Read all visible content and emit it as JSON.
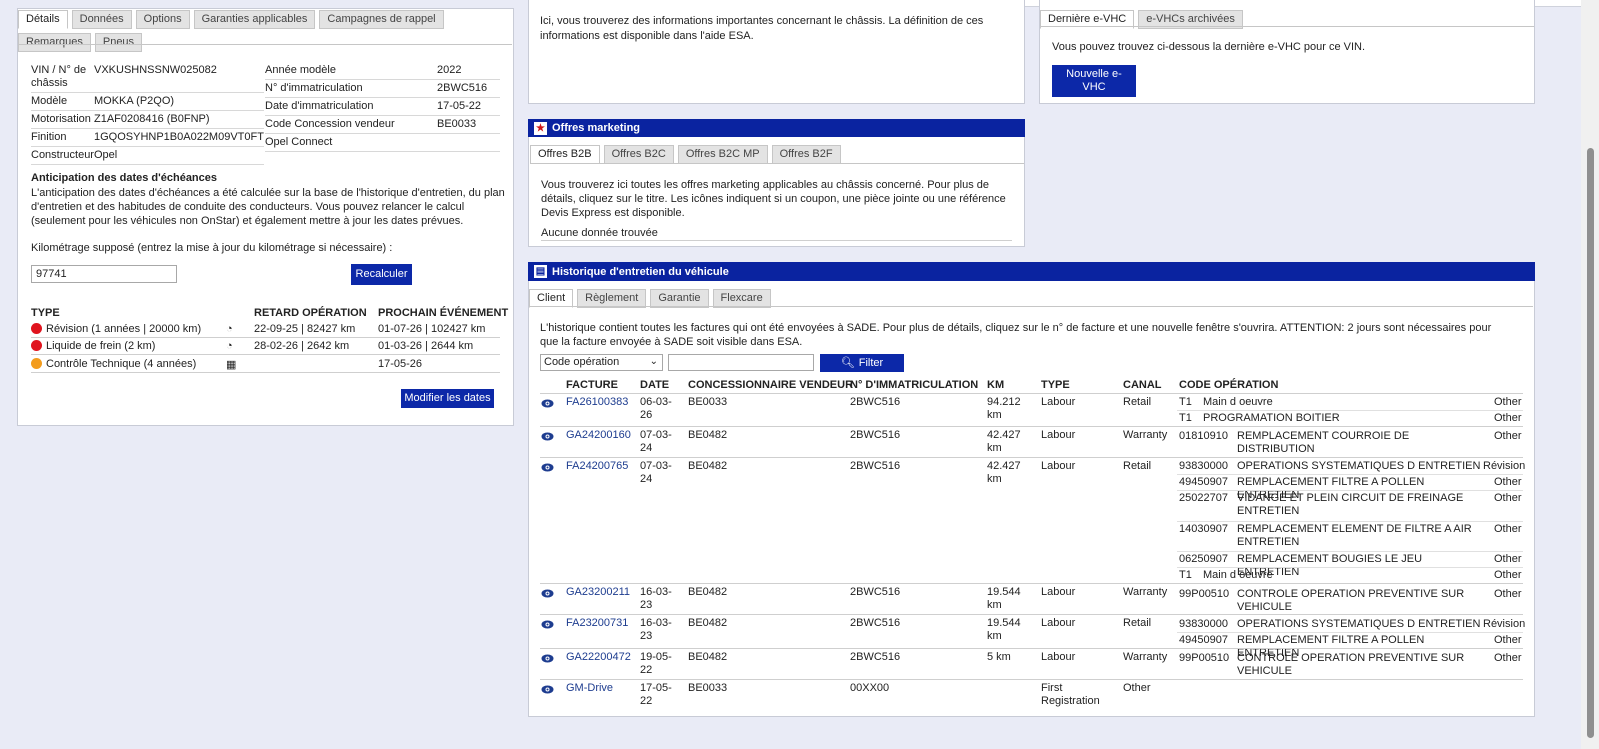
{
  "vehicle_tabs": [
    "Détails",
    "Données",
    "Options",
    "Garanties applicables",
    "Campagnes de rappel",
    "Remarques",
    "Pneus"
  ],
  "details_left": [
    {
      "label": "VIN / N° de châssis",
      "value": "VXKUSHNSSNW025082"
    },
    {
      "label": "Modèle",
      "value": "MOKKA (P2QO)"
    },
    {
      "label": "Motorisation",
      "value": "Z1AF0208416 (B0FNP)"
    },
    {
      "label": "Finition",
      "value": "1GQOSYHNP1B0A022M09VT0FT"
    },
    {
      "label": "Constructeur",
      "value": "Opel"
    }
  ],
  "details_right": [
    {
      "label": "Année modèle",
      "value": "2022"
    },
    {
      "label": "N° d'immatriculation",
      "value": "2BWC516"
    },
    {
      "label": "Date d'immatriculation",
      "value": "17-05-22"
    },
    {
      "label": "Code Concession vendeur",
      "value": "BE0033"
    },
    {
      "label": "Opel Connect",
      "value": ""
    }
  ],
  "anticipation": {
    "title": "Anticipation des dates d'échéances",
    "text": "L'anticipation des dates d'échéances a été calculée sur la base de l'historique d'entretien, du plan d'entretien et des habitudes de conduite des conducteurs. Vous pouvez relancer le calcul (seulement pour les véhicules non OnStar) et également mettre à jour les dates prévues.",
    "mileage_label": "Kilométrage supposé (entrez la mise à jour du kilométrage si nécessaire) :",
    "mileage_value": "97741",
    "recalc_button": "Recalculer",
    "columns": [
      "TYPE",
      "RETARD OPÉRATION",
      "PROCHAIN ÉVÉNEMENT"
    ],
    "rows": [
      {
        "status": "red",
        "type": "Révision (1 années | 20000 km)",
        "icon": "gauge-icon",
        "late": "22-09-25 | 82427 km",
        "next": "01-07-26 | 102427 km"
      },
      {
        "status": "red",
        "type": "Liquide de frein (2 km)",
        "icon": "gauge-icon",
        "late": "28-02-26 | 2642 km",
        "next": "01-03-26 | 2644 km"
      },
      {
        "status": "orange",
        "type": "Contrôle Technique (4 années)",
        "icon": "calendar-icon",
        "late": "",
        "next": "17-05-26"
      }
    ],
    "modify_button": "Modifier les dates"
  },
  "chassis_info": {
    "text": "Ici, vous trouverez des informations importantes concernant le châssis. La définition de ces informations est disponible dans l'aide ESA."
  },
  "evhc": {
    "tabs": [
      "Dernière e-VHC",
      "e-VHCs archivées"
    ],
    "text": "Vous pouvez trouvez ci-dessous la dernière e-VHC pour ce VIN.",
    "button": "Nouvelle e-VHC"
  },
  "offers": {
    "title": "Offres marketing",
    "tabs": [
      "Offres B2B",
      "Offres B2C",
      "Offres B2C MP",
      "Offres B2F"
    ],
    "text": "Vous trouverez ici toutes les offres marketing applicables au châssis concerné. Pour plus de détails, cliquez sur le titre. Les icônes indiquent si un coupon, une pièce jointe ou une référence Devis Express est disponible.",
    "empty": "Aucune donnée trouvée"
  },
  "history": {
    "title": "Historique d'entretien du véhicule",
    "tabs": [
      "Client",
      "Règlement",
      "Garantie",
      "Flexcare"
    ],
    "text": "L'historique contient toutes les factures qui ont été envoyées à SADE. Pour plus de détails, cliquez sur le n° de facture et une nouvelle fenêtre s'ouvrira. ATTENTION: 2 jours sont nécessaires pour que la facture envoyée à SADE soit visible dans ESA.",
    "filter_select": "Code opération",
    "filter_value": "",
    "filter_button": "Filter",
    "columns": [
      "FACTURE",
      "DATE",
      "CONCESSIONNAIRE VENDEUR",
      "N° D'IMMATRICULATION",
      "KM",
      "TYPE",
      "CANAL",
      "CODE OPÉRATION"
    ],
    "rows": [
      {
        "invoice": "FA26100383",
        "date": "06-03-26",
        "dealer": "BE0033",
        "plate": "2BWC516",
        "km": "94.212 km",
        "type": "Labour",
        "channel": "Retail",
        "ops": [
          {
            "code": "T1",
            "desc": "Main d oeuvre",
            "cat": "Other"
          },
          {
            "code": "T1",
            "desc": "PROGRAMATION BOITIER",
            "cat": "Other"
          }
        ]
      },
      {
        "invoice": "GA24200160",
        "date": "07-03-24",
        "dealer": "BE0482",
        "plate": "2BWC516",
        "km": "42.427 km",
        "type": "Labour",
        "channel": "Warranty",
        "ops": [
          {
            "code": "01810910",
            "desc": "REMPLACEMENT COURROIE DE DISTRIBUTION",
            "cat": "Other"
          }
        ]
      },
      {
        "invoice": "FA24200765",
        "date": "07-03-24",
        "dealer": "BE0482",
        "plate": "2BWC516",
        "km": "42.427 km",
        "type": "Labour",
        "channel": "Retail",
        "ops": [
          {
            "code": "93830000",
            "desc": "OPERATIONS SYSTEMATIQUES D ENTRETIEN",
            "cat": "Révision"
          },
          {
            "code": "49450907",
            "desc": "REMPLACEMENT FILTRE A POLLEN ENTRETIEN",
            "cat": "Other"
          },
          {
            "code": "25022707",
            "desc": "VIDANGE ET PLEIN CIRCUIT DE FREINAGE ENTRETIEN",
            "cat": "Other"
          },
          {
            "code": "14030907",
            "desc": "REMPLACEMENT ELEMENT DE FILTRE A AIR ENTRETIEN",
            "cat": "Other"
          },
          {
            "code": "06250907",
            "desc": "REMPLACEMENT BOUGIES LE JEU ENTRETIEN",
            "cat": "Other"
          },
          {
            "code": "T1",
            "desc": "Main d oeuvre",
            "cat": "Other"
          }
        ]
      },
      {
        "invoice": "GA23200211",
        "date": "16-03-23",
        "dealer": "BE0482",
        "plate": "2BWC516",
        "km": "19.544 km",
        "type": "Labour",
        "channel": "Warranty",
        "ops": [
          {
            "code": "99P00510",
            "desc": "CONTROLE OPERATION PREVENTIVE SUR VEHICULE",
            "cat": "Other"
          }
        ]
      },
      {
        "invoice": "FA23200731",
        "date": "16-03-23",
        "dealer": "BE0482",
        "plate": "2BWC516",
        "km": "19.544 km",
        "type": "Labour",
        "channel": "Retail",
        "ops": [
          {
            "code": "93830000",
            "desc": "OPERATIONS SYSTEMATIQUES D ENTRETIEN",
            "cat": "Révision"
          },
          {
            "code": "49450907",
            "desc": "REMPLACEMENT FILTRE A POLLEN ENTRETIEN",
            "cat": "Other"
          }
        ]
      },
      {
        "invoice": "GA22200472",
        "date": "19-05-22",
        "dealer": "BE0482",
        "plate": "2BWC516",
        "km": "5 km",
        "type": "Labour",
        "channel": "Warranty",
        "ops": [
          {
            "code": "99P00510",
            "desc": "CONTROLE OPERATION PREVENTIVE SUR VEHICULE",
            "cat": "Other"
          }
        ]
      },
      {
        "invoice": "GM-Drive",
        "date": "17-05-22",
        "dealer": "BE0033",
        "plate": "00XX00",
        "km": "",
        "type": "First Registration",
        "channel": "Other",
        "ops": []
      }
    ]
  },
  "colors": {
    "header_blue": "#0a23a0",
    "button_blue": "#0c28a8",
    "status_red": "#e0141e",
    "status_orange": "#f39c1d",
    "link": "#1d3c8f"
  }
}
